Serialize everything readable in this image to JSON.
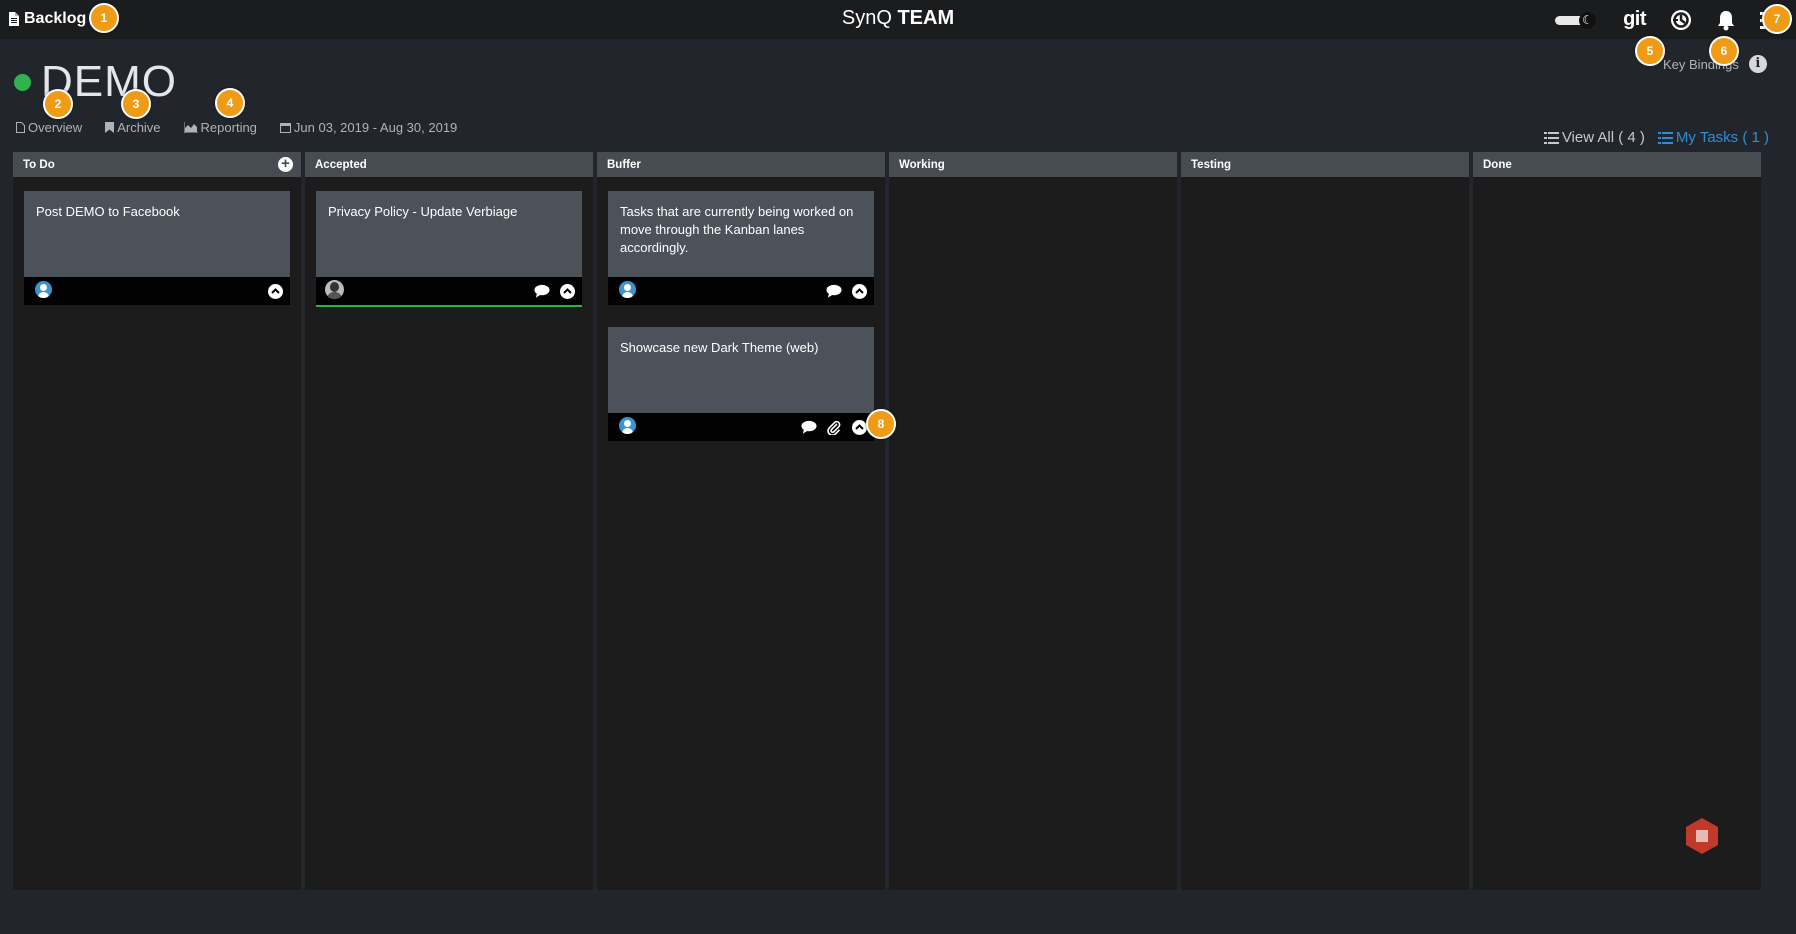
{
  "topbar": {
    "backlog_label": "Backlog",
    "brand_light": "SynQ",
    "brand_bold": "TEAM",
    "git_label": "git",
    "theme_toggle_icon": "moon-icon",
    "icons": [
      "git-icon",
      "history-icon",
      "bell-icon",
      "menu-icon"
    ]
  },
  "project": {
    "title": "DEMO",
    "status_color": "#2fb34f",
    "key_bindings_label": "Key Bindings",
    "subnav": {
      "overview": "Overview",
      "archive": "Archive",
      "reporting": "Reporting",
      "date_range": "Jun 03, 2019 - Aug 30, 2019"
    },
    "view_all_label": "View All ( 4 )",
    "my_tasks_label": "My Tasks ( 1 )"
  },
  "badges": [
    "1",
    "2",
    "3",
    "4",
    "5",
    "6",
    "7",
    "8"
  ],
  "lanes": [
    {
      "title": "To Do"
    },
    {
      "title": "Accepted"
    },
    {
      "title": "Buffer"
    },
    {
      "title": "Working"
    },
    {
      "title": "Testing"
    },
    {
      "title": "Done"
    }
  ],
  "cards": {
    "todo_1": "Post DEMO to Facebook",
    "accepted_1": "Privacy Policy - Update Verbiage",
    "buffer_1": "Tasks that are currently being worked on move through the Kanban lanes accordingly.",
    "buffer_2": "Showcase new Dark Theme (web)"
  },
  "colors": {
    "accent_badge": "#f09b16",
    "link_blue": "#2c8fd3",
    "card_accent_green": "#29b34a",
    "stop_button": "#c0392b"
  }
}
